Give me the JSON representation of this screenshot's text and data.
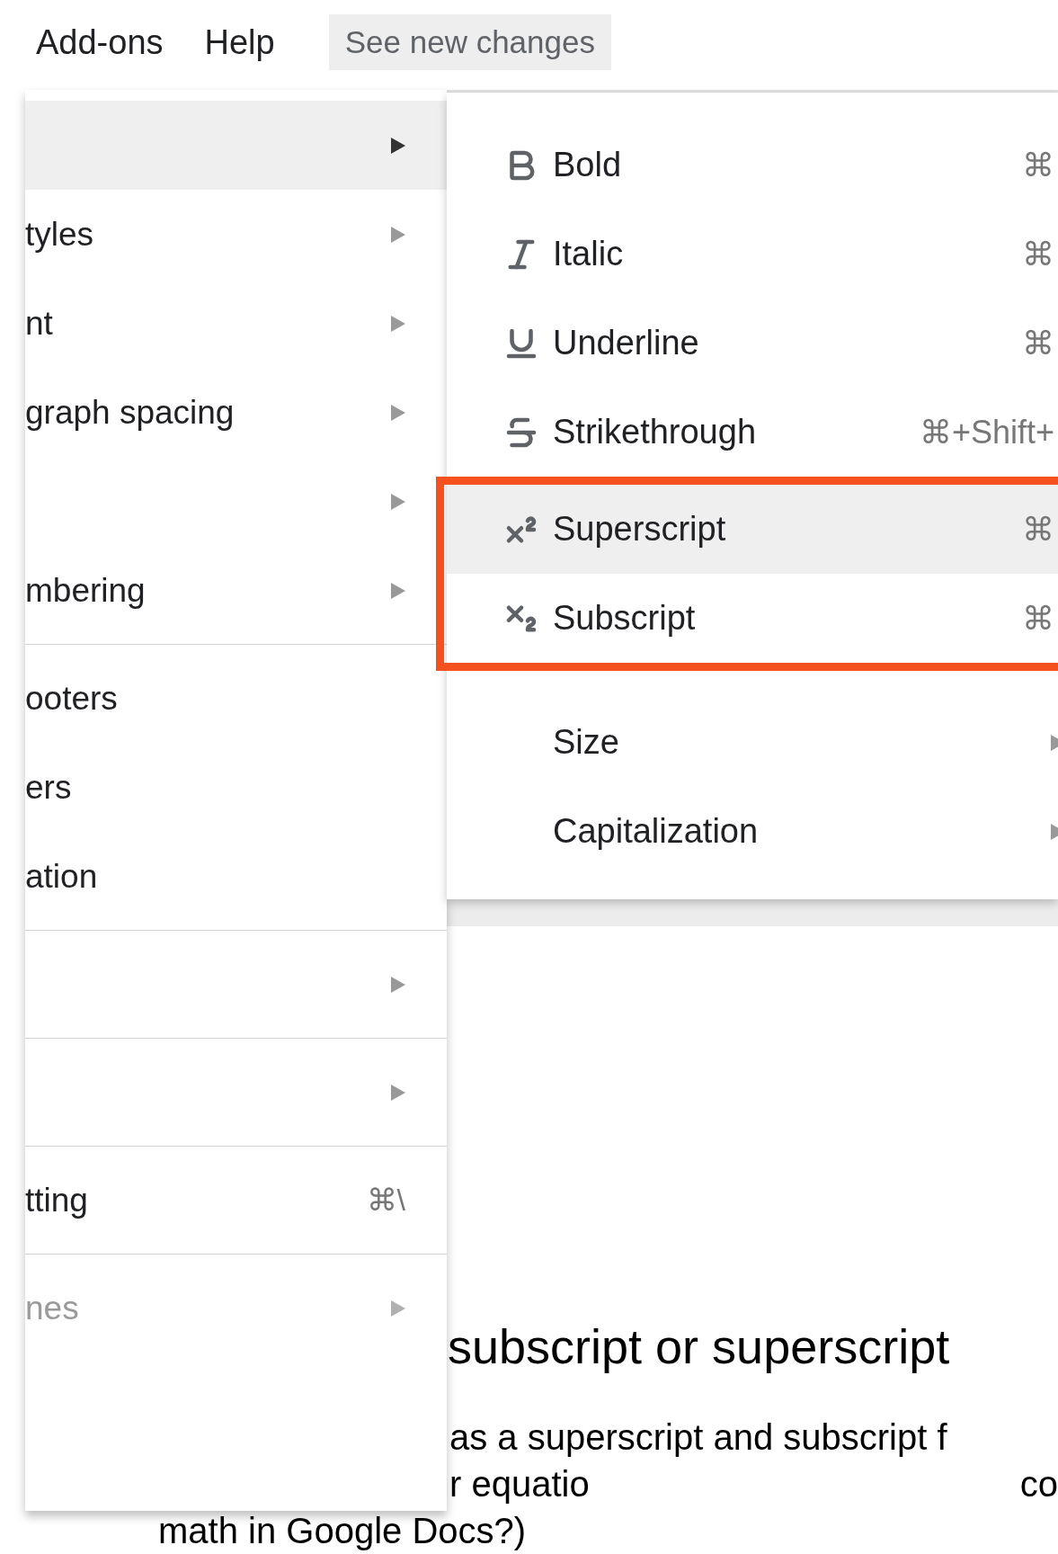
{
  "menu_bar": {
    "items": [
      "Add-ons",
      "Help"
    ],
    "changes_button": "See new changes"
  },
  "format_menu": {
    "items": [
      {
        "kind": "submenu",
        "selected": true,
        "disabled": false
      },
      {
        "kind": "submenu",
        "label": "tyles",
        "selected": false,
        "disabled": false
      },
      {
        "kind": "submenu",
        "label": "nt",
        "selected": false,
        "disabled": false
      },
      {
        "kind": "submenu",
        "label": "graph spacing",
        "selected": false,
        "disabled": false
      },
      {
        "kind": "submenu",
        "selected": false,
        "disabled": false
      },
      {
        "kind": "submenu",
        "label": "mbering",
        "selected": false,
        "disabled": false
      },
      {
        "kind": "divider"
      },
      {
        "kind": "action",
        "label": "ooters",
        "selected": false,
        "disabled": false
      },
      {
        "kind": "action",
        "label": "ers",
        "selected": false,
        "disabled": false
      },
      {
        "kind": "action",
        "label": "ation",
        "selected": false,
        "disabled": false
      },
      {
        "kind": "divider"
      },
      {
        "kind": "submenu",
        "selected": false,
        "disabled": false
      },
      {
        "kind": "divider"
      },
      {
        "kind": "submenu",
        "selected": false,
        "disabled": false
      },
      {
        "kind": "divider"
      },
      {
        "kind": "action",
        "label": "tting",
        "shortcut": "⌘\\",
        "selected": false,
        "disabled": false
      },
      {
        "kind": "divider"
      },
      {
        "kind": "submenu",
        "label": "nes",
        "selected": false,
        "disabled": true
      }
    ]
  },
  "text_menu": {
    "items": [
      {
        "kind": "action",
        "label": "Bold",
        "shortcut": "⌘",
        "selected": false,
        "marked": false
      },
      {
        "kind": "action",
        "label": "Italic",
        "shortcut": "⌘",
        "selected": false,
        "marked": false
      },
      {
        "kind": "action",
        "label": "Underline",
        "shortcut": "⌘",
        "selected": false,
        "marked": false
      },
      {
        "kind": "action",
        "label": "Strikethrough",
        "shortcut": "⌘+Shift+",
        "selected": false,
        "marked": false
      },
      {
        "kind": "action",
        "label": "Superscript",
        "shortcut": "⌘",
        "selected": true,
        "marked": true
      },
      {
        "kind": "action",
        "label": "Subscript",
        "shortcut": "⌘",
        "selected": false,
        "marked": true
      },
      {
        "kind": "submenu",
        "label": "Size",
        "selected": false,
        "marked": false
      },
      {
        "kind": "submenu",
        "label": "Capitalization",
        "selected": false,
        "marked": false
      }
    ]
  },
  "document": {
    "heading": "subscript or superscript",
    "lines": [
      [
        "as a superscript and subscript f"
      ],
      [
        "r equatio",
        "co"
      ],
      [
        "math in Google Docs?)"
      ]
    ]
  }
}
